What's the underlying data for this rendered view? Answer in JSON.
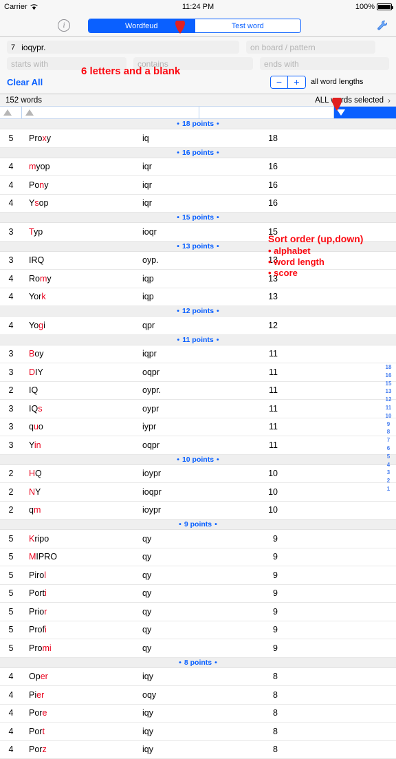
{
  "statusbar": {
    "carrier": "Carrier",
    "wifi_icon": "wifi-icon",
    "time": "11:24 PM",
    "battery_pct": "100%",
    "battery_icon": "battery-icon"
  },
  "navbar": {
    "info_icon": "info-icon",
    "info_glyph": "i",
    "tabs": [
      {
        "label": "Wordfeud",
        "active": true
      },
      {
        "label": "Test word",
        "active": false
      }
    ],
    "wrench_icon": "wrench-icon"
  },
  "search": {
    "rack_count": "7",
    "rack_value": "ioqypr.",
    "board_placeholder": "on board / pattern",
    "starts_with_placeholder": "starts with",
    "contains_placeholder": "contains",
    "ends_with_placeholder": "ends with",
    "clear_all_label": "Clear All",
    "minus_label": "−",
    "plus_label": "+",
    "word_lengths_label": "all word lengths"
  },
  "listheader": {
    "count_label": "152 words",
    "selection_label": "ALL words selected",
    "chevron_icon": "chevron-right-icon"
  },
  "sortbar": {
    "sort_length_icon": "triangle-up-icon",
    "sort_alphabet_icon": "triangle-up-icon",
    "sort_score_icon": "triangle-down-icon"
  },
  "annotations": {
    "letters_note": "6 letters and a blank",
    "sort_note": "Sort order (up,down)",
    "bullet_alphabet": "• alphabet",
    "bullet_word_length": "• word length",
    "bullet_score": "• score"
  },
  "index_rail": [
    "18",
    "16",
    "15",
    "13",
    "12",
    "11",
    "10",
    "9",
    "8",
    "7",
    "6",
    "5",
    "4",
    "3",
    "2",
    "1"
  ],
  "colors": {
    "accent_blue": "#0a60ff",
    "group_blue": "#0a60ff",
    "annotation_red": "#fb0a12",
    "blank_letter_red": "#e8001c",
    "rail_blue": "#4a80f0"
  },
  "groups": [
    {
      "heading": "18 points",
      "rows": [
        {
          "length": "5",
          "word": [
            {
              "t": "Pro",
              "r": false
            },
            {
              "t": "x",
              "r": true
            },
            {
              "t": "y",
              "r": false
            }
          ],
          "pattern": "iq",
          "score": "18"
        }
      ]
    },
    {
      "heading": "16 points",
      "rows": [
        {
          "length": "4",
          "word": [
            {
              "t": "m",
              "r": true
            },
            {
              "t": "yop",
              "r": false
            }
          ],
          "pattern": "iqr",
          "score": "16"
        },
        {
          "length": "4",
          "word": [
            {
              "t": "Po",
              "r": false
            },
            {
              "t": "n",
              "r": true
            },
            {
              "t": "y",
              "r": false
            }
          ],
          "pattern": "iqr",
          "score": "16"
        },
        {
          "length": "4",
          "word": [
            {
              "t": "Y",
              "r": false
            },
            {
              "t": "s",
              "r": true
            },
            {
              "t": "op",
              "r": false
            }
          ],
          "pattern": "iqr",
          "score": "16"
        }
      ]
    },
    {
      "heading": "15 points",
      "rows": [
        {
          "length": "3",
          "word": [
            {
              "t": "T",
              "r": true
            },
            {
              "t": "yp",
              "r": false
            }
          ],
          "pattern": "ioqr",
          "score": "15"
        }
      ]
    },
    {
      "heading": "13 points",
      "rows": [
        {
          "length": "3",
          "word": [
            {
              "t": "IRQ",
              "r": false
            }
          ],
          "pattern": "oyp.",
          "score": "13"
        },
        {
          "length": "4",
          "word": [
            {
              "t": "Ro",
              "r": false
            },
            {
              "t": "m",
              "r": true
            },
            {
              "t": "y",
              "r": false
            }
          ],
          "pattern": "iqp",
          "score": "13"
        },
        {
          "length": "4",
          "word": [
            {
              "t": "Yor",
              "r": false
            },
            {
              "t": "k",
              "r": true
            }
          ],
          "pattern": "iqp",
          "score": "13"
        }
      ]
    },
    {
      "heading": "12 points",
      "rows": [
        {
          "length": "4",
          "word": [
            {
              "t": "Yo",
              "r": false
            },
            {
              "t": "g",
              "r": true
            },
            {
              "t": "i",
              "r": false
            }
          ],
          "pattern": "qpr",
          "score": "12"
        }
      ]
    },
    {
      "heading": "11 points",
      "rows": [
        {
          "length": "3",
          "word": [
            {
              "t": "B",
              "r": true
            },
            {
              "t": "oy",
              "r": false
            }
          ],
          "pattern": "iqpr",
          "score": "11"
        },
        {
          "length": "3",
          "word": [
            {
              "t": "D",
              "r": true
            },
            {
              "t": "IY",
              "r": false
            }
          ],
          "pattern": "oqpr",
          "score": "11"
        },
        {
          "length": "2",
          "word": [
            {
              "t": "IQ",
              "r": false
            }
          ],
          "pattern": "oypr.",
          "score": "11"
        },
        {
          "length": "3",
          "word": [
            {
              "t": "IQ",
              "r": false
            },
            {
              "t": "s",
              "r": true
            }
          ],
          "pattern": "oypr",
          "score": "11"
        },
        {
          "length": "3",
          "word": [
            {
              "t": "q",
              "r": false
            },
            {
              "t": "u",
              "r": true
            },
            {
              "t": "o",
              "r": false
            }
          ],
          "pattern": "iypr",
          "score": "11"
        },
        {
          "length": "3",
          "word": [
            {
              "t": "Y",
              "r": false
            },
            {
              "t": "in",
              "r": true
            }
          ],
          "pattern": "oqpr",
          "score": "11"
        }
      ]
    },
    {
      "heading": "10 points",
      "rows": [
        {
          "length": "2",
          "word": [
            {
              "t": "H",
              "r": true
            },
            {
              "t": "Q",
              "r": false
            }
          ],
          "pattern": "ioypr",
          "score": "10"
        },
        {
          "length": "2",
          "word": [
            {
              "t": "N",
              "r": true
            },
            {
              "t": "Y",
              "r": false
            }
          ],
          "pattern": "ioqpr",
          "score": "10"
        },
        {
          "length": "2",
          "word": [
            {
              "t": "q",
              "r": false
            },
            {
              "t": "m",
              "r": true
            }
          ],
          "pattern": "ioypr",
          "score": "10"
        }
      ]
    },
    {
      "heading": "9 points",
      "rows": [
        {
          "length": "5",
          "word": [
            {
              "t": "K",
              "r": true
            },
            {
              "t": "ripo",
              "r": false
            }
          ],
          "pattern": "qy",
          "score": "9"
        },
        {
          "length": "5",
          "word": [
            {
              "t": "M",
              "r": true
            },
            {
              "t": "IPRO",
              "r": false
            }
          ],
          "pattern": "qy",
          "score": "9"
        },
        {
          "length": "5",
          "word": [
            {
              "t": "Piro",
              "r": false
            },
            {
              "t": "l",
              "r": true
            }
          ],
          "pattern": "qy",
          "score": "9"
        },
        {
          "length": "5",
          "word": [
            {
              "t": "Port",
              "r": false
            },
            {
              "t": "i",
              "r": true
            }
          ],
          "pattern": "qy",
          "score": "9"
        },
        {
          "length": "5",
          "word": [
            {
              "t": "Prio",
              "r": false
            },
            {
              "t": "r",
              "r": true
            }
          ],
          "pattern": "qy",
          "score": "9"
        },
        {
          "length": "5",
          "word": [
            {
              "t": "Prof",
              "r": false
            },
            {
              "t": "i",
              "r": true
            }
          ],
          "pattern": "qy",
          "score": "9"
        },
        {
          "length": "5",
          "word": [
            {
              "t": "Pro",
              "r": false
            },
            {
              "t": "mi",
              "r": true
            }
          ],
          "pattern": "qy",
          "score": "9"
        }
      ]
    },
    {
      "heading": "8 points",
      "rows": [
        {
          "length": "4",
          "word": [
            {
              "t": "Op",
              "r": false
            },
            {
              "t": "er",
              "r": true
            }
          ],
          "pattern": "iqy",
          "score": "8"
        },
        {
          "length": "4",
          "word": [
            {
              "t": "Pi",
              "r": false
            },
            {
              "t": "er",
              "r": true
            }
          ],
          "pattern": "oqy",
          "score": "8"
        },
        {
          "length": "4",
          "word": [
            {
              "t": "Por",
              "r": false
            },
            {
              "t": "e",
              "r": true
            }
          ],
          "pattern": "iqy",
          "score": "8"
        },
        {
          "length": "4",
          "word": [
            {
              "t": "Por",
              "r": false
            },
            {
              "t": "t",
              "r": true
            }
          ],
          "pattern": "iqy",
          "score": "8"
        },
        {
          "length": "4",
          "word": [
            {
              "t": "Por",
              "r": false
            },
            {
              "t": "z",
              "r": true
            }
          ],
          "pattern": "iqy",
          "score": "8"
        }
      ]
    }
  ]
}
